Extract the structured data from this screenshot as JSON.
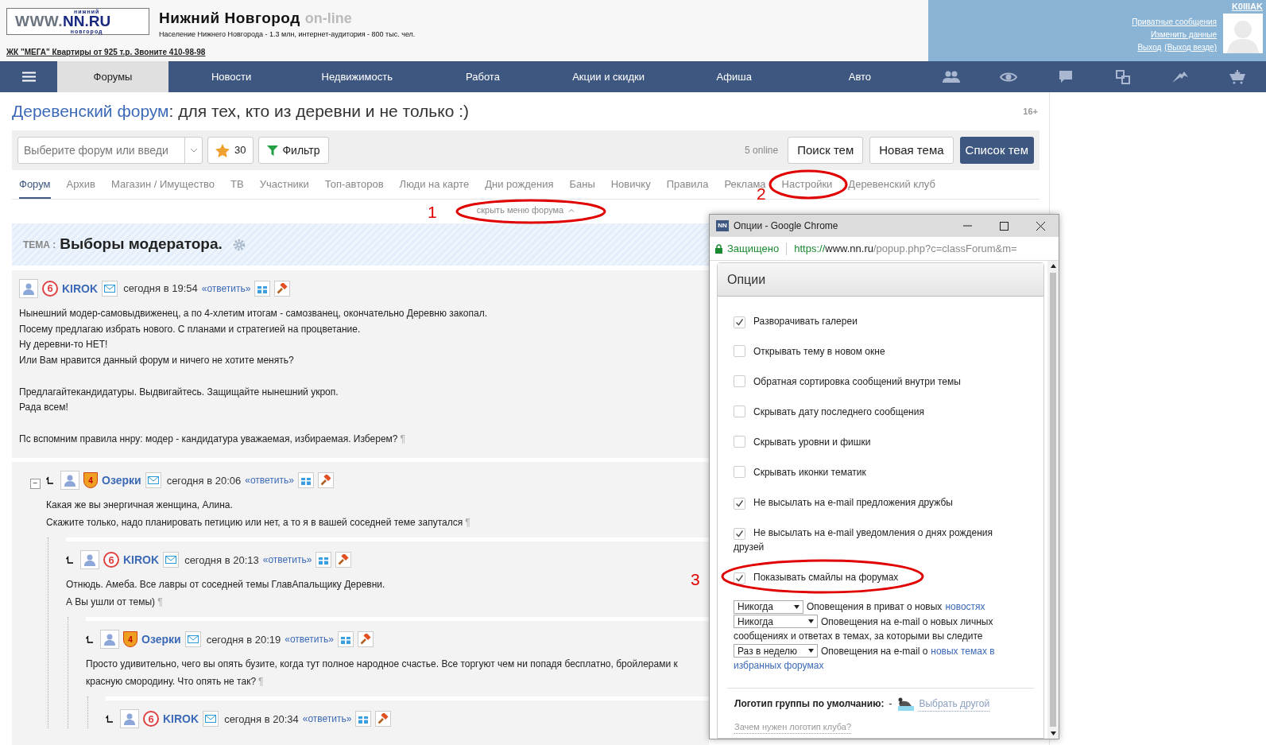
{
  "header": {
    "logo_top": "нижний",
    "logo_www": "WWW.",
    "logo_nn": "NN.RU",
    "logo_bottom": "новгород",
    "site_title": "Нижний Новгород",
    "site_suffix": "on-line",
    "tagline": "Население Нижнего Новгорода - 1.3 млн, интернет-аудитория - 800 тыс. чел.",
    "ad_link": "ЖК \"МЕГА\" Квартиры от 925 т.р. Звоните 410-98-98"
  },
  "user_panel": {
    "username": "K0IIIAK",
    "links": [
      [
        "Приватные сообщения"
      ],
      [
        "Изменить данные"
      ],
      [
        "Выход",
        "(Выход везде)"
      ]
    ]
  },
  "nav": {
    "items": [
      {
        "label": "Форумы",
        "selected": true
      },
      {
        "label": "Новости",
        "selected": false
      },
      {
        "label": "Недвижимость",
        "selected": false
      },
      {
        "label": "Работа",
        "selected": false
      },
      {
        "label": "Акции и скидки",
        "selected": false
      },
      {
        "label": "Афиша",
        "selected": false
      },
      {
        "label": "Авто",
        "selected": false
      }
    ]
  },
  "forum": {
    "title_link": "Деревенский форум",
    "title_rest": ": для тех, кто из деревни и не только :)",
    "age": "16+"
  },
  "toolbar": {
    "forum_select_placeholder": "Выберите форум или введи",
    "favorites_count": "30",
    "filter": "Фильтр",
    "online": "5 online",
    "buttons": [
      {
        "label": "Поиск тем",
        "kind": "default"
      },
      {
        "label": "Новая тема",
        "kind": "default"
      },
      {
        "label": "Список тем",
        "kind": "primary"
      }
    ]
  },
  "tabs": [
    {
      "label": "Форум",
      "selected": true
    },
    {
      "label": "Архив",
      "selected": false
    },
    {
      "label": "Магазин / Имущество",
      "selected": false
    },
    {
      "label": "ТВ",
      "selected": false
    },
    {
      "label": "Участники",
      "selected": false
    },
    {
      "label": "Топ-авторов",
      "selected": false
    },
    {
      "label": "Люди на карте",
      "selected": false
    },
    {
      "label": "Дни рождения",
      "selected": false
    },
    {
      "label": "Баны",
      "selected": false
    },
    {
      "label": "Новичку",
      "selected": false
    },
    {
      "label": "Правила",
      "selected": false
    },
    {
      "label": "Реклама",
      "selected": false
    },
    {
      "label": "Настройки",
      "selected": false
    },
    {
      "label": "Деревенский клуб",
      "selected": false
    }
  ],
  "hide_menu": "скрыть меню форума",
  "topic": {
    "label": "ТЕМА :",
    "title": "Выборы модератора."
  },
  "opening_post": {
    "author": "KIROK",
    "rank": "6",
    "kind": "ring",
    "time": "сегодня в 19:54",
    "reply": "«ответить»",
    "paragraphs": [
      [
        "Нынешний модер-самовыдвиженец, а по 4-хлетим итогам - самозванец, окончательно Деревню закопал.",
        "Посему предлагаю избрать нового. С планами и стратегией на процветание.",
        "Ну деревни-то НЕТ!",
        "Или Вам нравится данный форум и ничего не хотите менять?"
      ],
      [
        "Предлагайтекандидатуры. Выдвигайтесь. Защищайте нынешний укроп.",
        "Рада всем!"
      ],
      [
        "Пс вспомним правила ннру: модер - кандидатура уважаемая, избираемая. Изберем?"
      ]
    ],
    "end_mark": "¶"
  },
  "replies": [
    {
      "author": "Озерки",
      "rank": "4",
      "kind": "crest",
      "time": "сегодня в 20:06",
      "reply": "«ответить»",
      "collapse": "−",
      "lines": [
        "Какая же вы энергичная женщина, Алина.",
        "Скажите только, надо планировать петицию или нет, а то я в вашей соседней теме запутался"
      ],
      "end_mark": "¶",
      "children": [
        {
          "author": "KIROK",
          "rank": "6",
          "kind": "ring",
          "time": "сегодня в 20:13",
          "reply": "«ответить»",
          "lines": [
            "Отнюдь. Амеба. Все лавры от соседней темы ГлавАпальщику Деревни.",
            "А Вы ушли от темы)"
          ],
          "end_mark": "¶",
          "children": [
            {
              "author": "Озерки",
              "rank": "4",
              "kind": "crest",
              "time": "сегодня в 20:19",
              "reply": "«ответить»",
              "lines": [
                "Просто удивительно, чего вы опять бузите, когда тут полное народное счастье. Все торгуют чем ни попадя бесплатно, бройлерами к",
                "красную смородину. Что опять не так?"
              ],
              "end_mark": "¶",
              "children": [
                {
                  "author": "KIROK",
                  "rank": "6",
                  "kind": "ring",
                  "time": "сегодня в 20:34",
                  "reply": "«ответить»"
                }
              ]
            }
          ]
        }
      ]
    }
  ],
  "popup": {
    "app_icon": "NN",
    "window_title": "Опции - Google Chrome",
    "secure": "Защищено",
    "url_scheme": "https://",
    "url_host": "www.nn.ru",
    "url_path": "/popup.php?c=classForum&m=",
    "panel_title": "Опции",
    "options": [
      {
        "label": "Разворачивать галереи",
        "checked": true
      },
      {
        "label": "Открывать тему в новом окне",
        "checked": false
      },
      {
        "label": "Обратная сортировка сообщений внутри темы",
        "checked": false
      },
      {
        "label": "Скрывать дату последнего сообщения",
        "checked": false
      },
      {
        "label": "Скрывать уровни и фишки",
        "checked": false
      },
      {
        "label": "Скрывать иконки тематик",
        "checked": false
      },
      {
        "label": "Не высылать на e-mail предложения дружбы",
        "checked": true
      },
      {
        "label": "Не высылать на e-mail уведомления о днях рождения друзей",
        "checked": true
      },
      {
        "label": "Показывать смайлы на форумах",
        "checked": true
      }
    ],
    "notifications": [
      {
        "value": "Никогда",
        "lines": [
          [
            {
              "text": "Оповещения в приват о новых",
              "link": false
            },
            {
              "text": "новостях",
              "link": true
            }
          ]
        ]
      },
      {
        "value": "Никогда",
        "lines": [
          [
            {
              "text": "Оповещения на e-mail о новых личных",
              "link": false
            }
          ],
          [
            {
              "text": "сообщениях и ответах в темах, за которыми вы следите",
              "link": false
            }
          ]
        ]
      },
      {
        "value": "Раз в неделю",
        "lines": [
          [
            {
              "text": "Оповещения на e-mail о",
              "link": false
            },
            {
              "text": "новых темах в",
              "link": true
            }
          ],
          [
            {
              "text": "избранных форумах",
              "link": true
            }
          ]
        ]
      }
    ],
    "logo_label": "Логотип группы по умолчанию:",
    "logo_dash": "-",
    "logo_change": "Выбрать другой",
    "logo_help": "Зачем нужен логотип клуба?"
  },
  "annotations": [
    "1",
    "2",
    "3"
  ]
}
